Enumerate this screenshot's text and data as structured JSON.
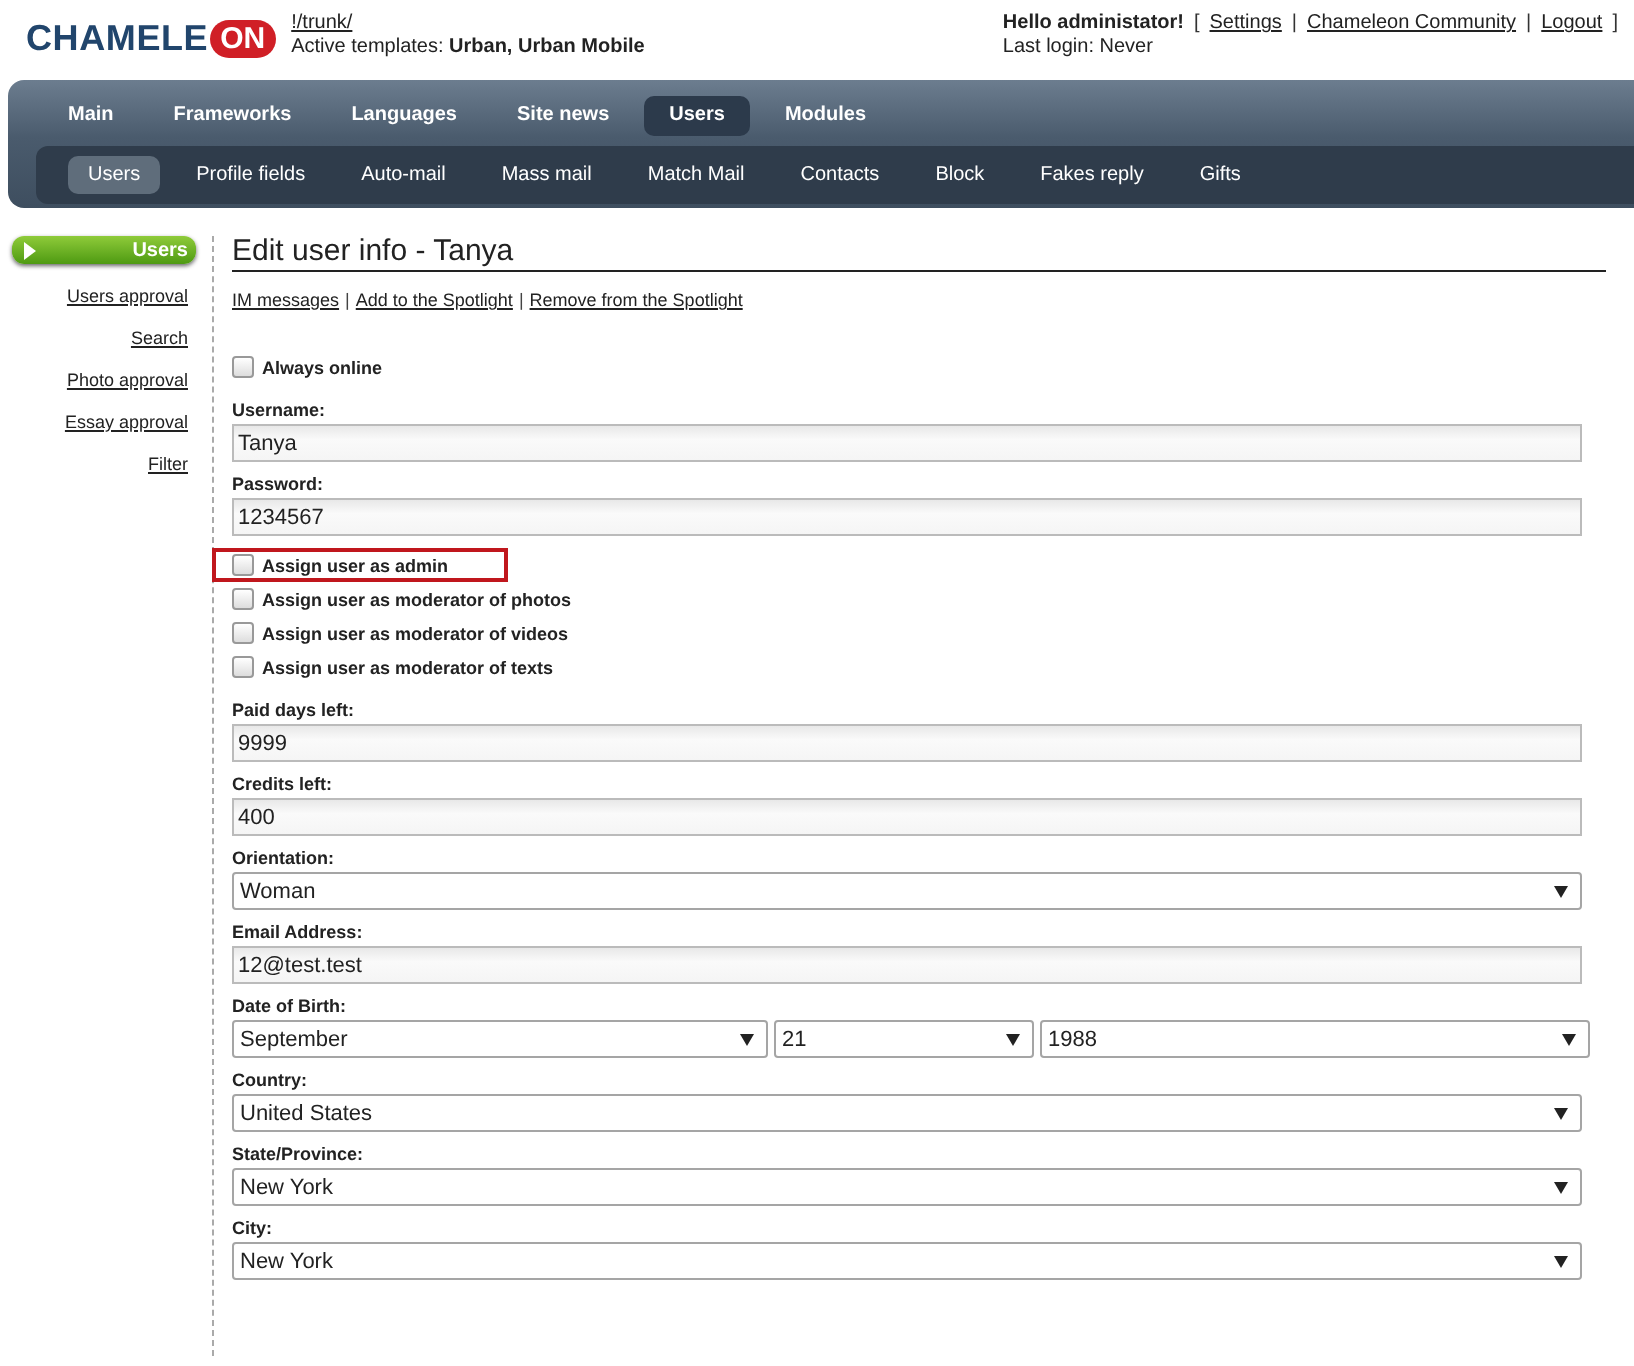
{
  "logo": {
    "text": "CHAMELE",
    "badge": "ON"
  },
  "site": {
    "path": "!/trunk/",
    "templates_label": "Active templates:",
    "templates": "Urban, Urban Mobile"
  },
  "account": {
    "greeting": "Hello administator!",
    "open_bracket": "[",
    "separator": "|",
    "close_bracket": "]",
    "links": [
      "Settings",
      "Chameleon Community",
      "Logout"
    ],
    "last_login": "Last login: Never"
  },
  "main_nav": [
    {
      "label": "Main",
      "selected": false
    },
    {
      "label": "Frameworks",
      "selected": false
    },
    {
      "label": "Languages",
      "selected": false
    },
    {
      "label": "Site news",
      "selected": false
    },
    {
      "label": "Users",
      "selected": true
    },
    {
      "label": "Modules",
      "selected": false
    }
  ],
  "sub_nav": [
    {
      "label": "Users",
      "selected": true
    },
    {
      "label": "Profile fields",
      "selected": false
    },
    {
      "label": "Auto-mail",
      "selected": false
    },
    {
      "label": "Mass mail",
      "selected": false
    },
    {
      "label": "Match Mail",
      "selected": false
    },
    {
      "label": "Contacts",
      "selected": false
    },
    {
      "label": "Block",
      "selected": false
    },
    {
      "label": "Fakes reply",
      "selected": false
    },
    {
      "label": "Gifts",
      "selected": false
    }
  ],
  "sidebar": {
    "items": [
      {
        "label": "Users",
        "selected": true
      },
      {
        "label": "Users approval",
        "selected": false
      },
      {
        "label": "Search",
        "selected": false
      },
      {
        "label": "Photo approval",
        "selected": false
      },
      {
        "label": "Essay approval",
        "selected": false
      },
      {
        "label": "Filter",
        "selected": false
      }
    ]
  },
  "page": {
    "title": "Edit user info - Tanya",
    "separator": "|",
    "actions": [
      "IM messages",
      "Add to the Spotlight",
      "Remove from the Spotlight"
    ]
  },
  "fields": [
    {
      "kind": "checkboxes",
      "items": [
        {
          "label": "Always online",
          "checked": false,
          "highlighted": false
        }
      ]
    },
    {
      "kind": "text",
      "label": "Username:",
      "value": "Tanya"
    },
    {
      "kind": "text",
      "label": "Password:",
      "value": "1234567"
    },
    {
      "kind": "checkboxes",
      "items": [
        {
          "label": "Assign user as admin",
          "checked": false,
          "highlighted": true
        },
        {
          "label": "Assign user as moderator of photos",
          "checked": false,
          "highlighted": false
        },
        {
          "label": "Assign user as moderator of videos",
          "checked": false,
          "highlighted": false
        },
        {
          "label": "Assign user as moderator of texts",
          "checked": false,
          "highlighted": false
        }
      ]
    },
    {
      "kind": "text",
      "label": "Paid days left:",
      "value": "9999"
    },
    {
      "kind": "text",
      "label": "Credits left:",
      "value": "400"
    },
    {
      "kind": "select",
      "label": "Orientation:",
      "values": [
        "Woman"
      ]
    },
    {
      "kind": "text",
      "label": "Email Address:",
      "value": "12@test.test"
    },
    {
      "kind": "select",
      "label": "Date of Birth:",
      "values": [
        "September",
        "21",
        "1988"
      ]
    },
    {
      "kind": "select",
      "label": "Country:",
      "values": [
        "United States"
      ]
    },
    {
      "kind": "select",
      "label": "State/Province:",
      "values": [
        "New York"
      ]
    },
    {
      "kind": "select",
      "label": "City:",
      "values": [
        "New York"
      ]
    }
  ]
}
